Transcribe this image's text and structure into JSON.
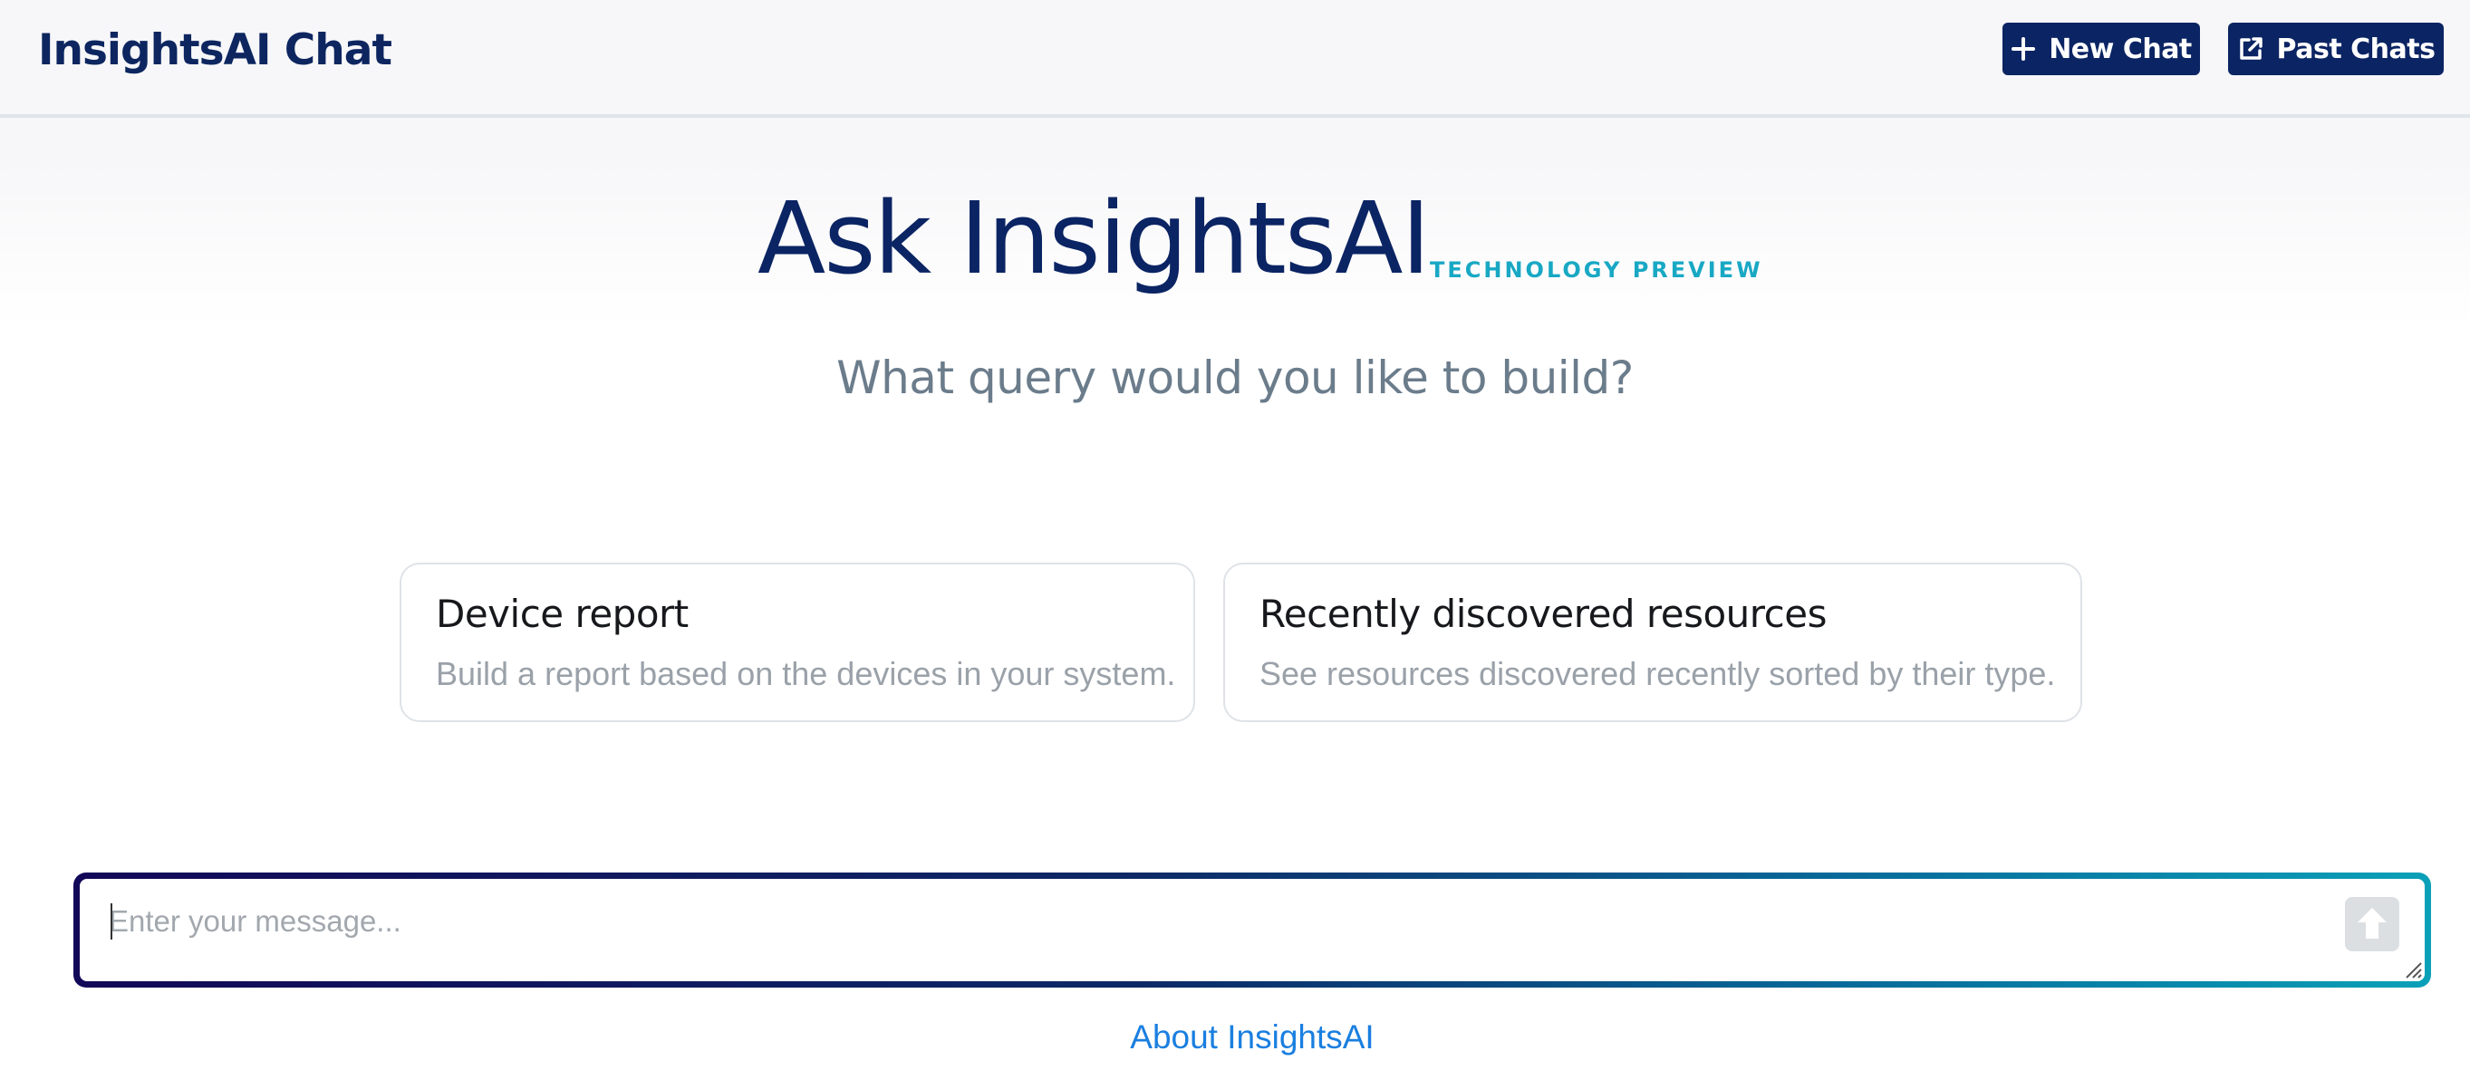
{
  "header": {
    "app_title": "InsightsAI Chat",
    "new_chat_label": "New Chat",
    "past_chats_label": "Past Chats"
  },
  "hero": {
    "title": "Ask InsightsAI",
    "badge": "TECHNOLOGY PREVIEW",
    "subtitle": "What query would you like to build?"
  },
  "suggestions": [
    {
      "title": "Device report",
      "description": "Build a report based on the devices in your system."
    },
    {
      "title": "Recently discovered resources",
      "description": "See resources discovered recently sorted by their type."
    }
  ],
  "composer": {
    "placeholder": "Enter your message...",
    "value": "",
    "send_icon": "arrow-up-icon"
  },
  "footer": {
    "about_link": "About InsightsAI"
  },
  "colors": {
    "brand_navy": "#0b2463",
    "accent_teal": "#18a8c4",
    "link_blue": "#1a7fe0"
  }
}
